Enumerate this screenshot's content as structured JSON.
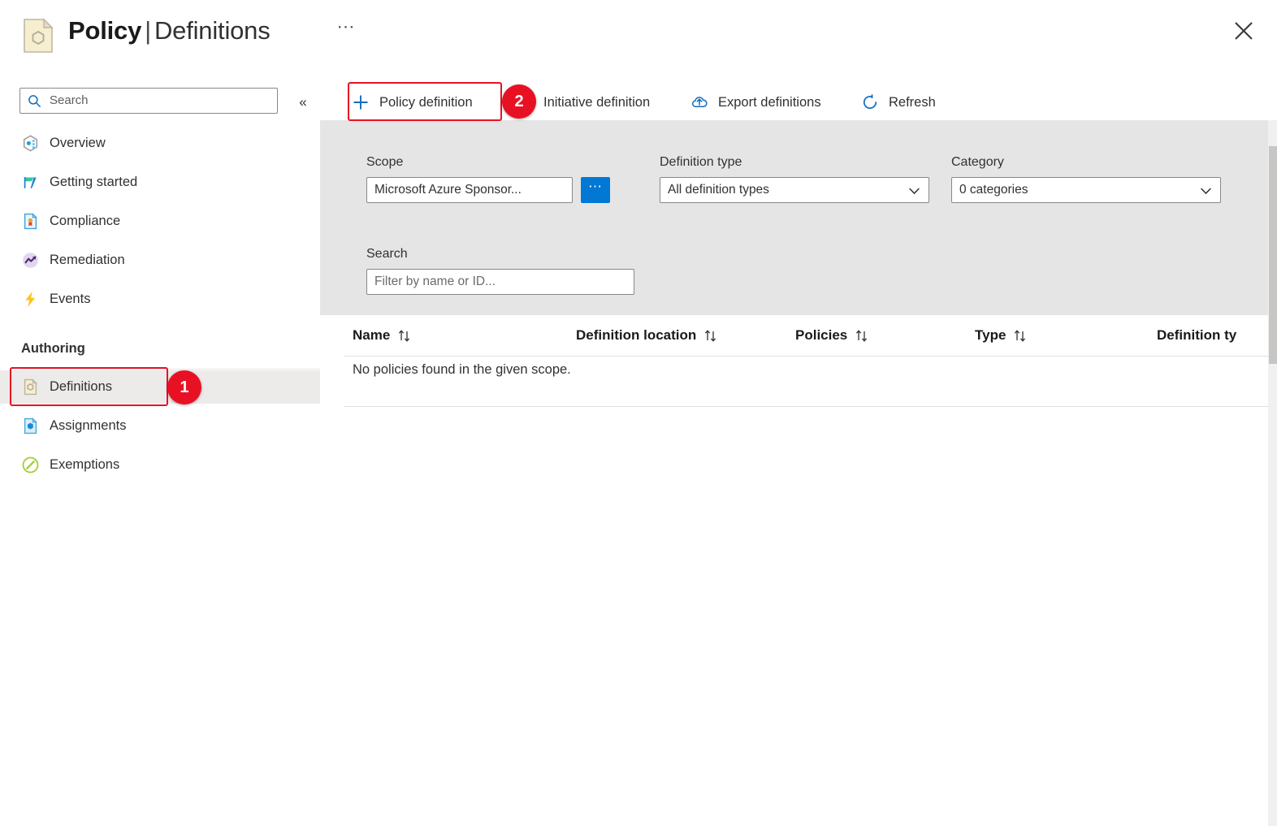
{
  "header": {
    "title_strong": "Policy",
    "title_separator": "|",
    "title_sub": "Definitions",
    "ellipsis_label": "⋯",
    "close_label": "Close",
    "icon": "policy-document-icon"
  },
  "sidebar": {
    "search": {
      "placeholder": "Search",
      "value": "",
      "icon": "search-icon"
    },
    "collapse_label": "«",
    "items": [
      {
        "label": "Overview",
        "icon": "overview-hexagon-icon",
        "selected": false
      },
      {
        "label": "Getting started",
        "icon": "flag-icon",
        "selected": false
      },
      {
        "label": "Compliance",
        "icon": "compliance-document-icon",
        "selected": false
      },
      {
        "label": "Remediation",
        "icon": "remediation-trend-icon",
        "selected": false
      },
      {
        "label": "Events",
        "icon": "lightning-bolt-icon",
        "selected": false
      }
    ],
    "section_title": "Authoring",
    "authoring_items": [
      {
        "label": "Definitions",
        "icon": "definitions-document-icon",
        "selected": true
      },
      {
        "label": "Assignments",
        "icon": "assignments-document-icon",
        "selected": false
      },
      {
        "label": "Exemptions",
        "icon": "exemptions-slash-icon",
        "selected": false
      }
    ]
  },
  "toolbar": {
    "buttons": [
      {
        "label": "Policy definition",
        "icon": "plus-icon"
      },
      {
        "label": "Initiative definition",
        "icon": "plus-icon"
      },
      {
        "label": "Export definitions",
        "icon": "cloud-upload-icon"
      },
      {
        "label": "Refresh",
        "icon": "refresh-icon"
      }
    ]
  },
  "filters": {
    "scope": {
      "label": "Scope",
      "value": "Microsoft Azure Sponsor...",
      "browse_label": "⋯"
    },
    "definition_type": {
      "label": "Definition type",
      "value": "All definition types"
    },
    "category": {
      "label": "Category",
      "value": "0 categories"
    },
    "search": {
      "label": "Search",
      "placeholder": "Filter by name or ID...",
      "value": ""
    }
  },
  "table": {
    "columns": [
      {
        "label": "Name"
      },
      {
        "label": "Definition location"
      },
      {
        "label": "Policies"
      },
      {
        "label": "Type"
      },
      {
        "label": "Definition ty"
      }
    ],
    "empty_message": "No policies found in the given scope."
  },
  "annotations": [
    {
      "number": "1",
      "target": "sidebar-item-definitions"
    },
    {
      "number": "2",
      "target": "toolbar-policy-definition"
    }
  ],
  "colors": {
    "accent": "#0078d4",
    "annotation": "#e81123",
    "filter_panel_bg": "#e5e5e5",
    "selected_nav_bg": "#edebe9"
  }
}
